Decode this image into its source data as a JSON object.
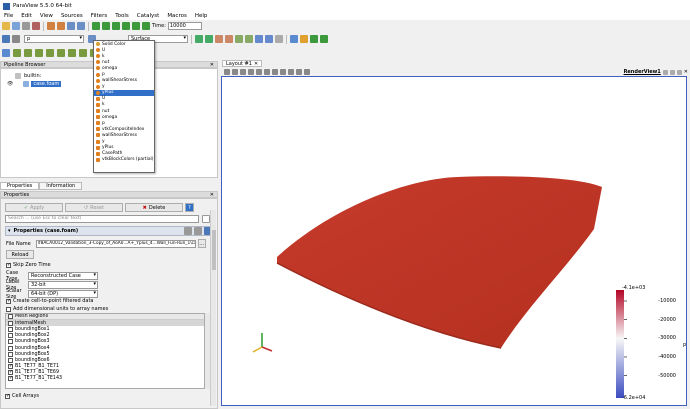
{
  "window": {
    "title": "ParaView 5.5.0 64-bit"
  },
  "menu": [
    "File",
    "Edit",
    "View",
    "Sources",
    "Filters",
    "Tools",
    "Catalyst",
    "Macros",
    "Help"
  ],
  "toolbar": {
    "time_label": "Time:",
    "time_value": "10000",
    "representation": "Surface",
    "coloring_value": "p"
  },
  "dropdown": {
    "items": [
      {
        "label": "Solid Color",
        "kind": "solid"
      },
      {
        "label": "U",
        "kind": "point"
      },
      {
        "label": "k",
        "kind": "point"
      },
      {
        "label": "nut",
        "kind": "point"
      },
      {
        "label": "omega",
        "kind": "point"
      },
      {
        "label": "p",
        "kind": "point"
      },
      {
        "label": "wallShearStress",
        "kind": "point"
      },
      {
        "label": "y",
        "kind": "point"
      },
      {
        "label": "yPlus",
        "kind": "point",
        "selected": true
      },
      {
        "label": "U",
        "kind": "cell"
      },
      {
        "label": "k",
        "kind": "cell"
      },
      {
        "label": "nut",
        "kind": "cell"
      },
      {
        "label": "omega",
        "kind": "cell"
      },
      {
        "label": "p",
        "kind": "cell"
      },
      {
        "label": "vtkCompositeIndex",
        "kind": "cell"
      },
      {
        "label": "wallShearStress",
        "kind": "cell"
      },
      {
        "label": "y",
        "kind": "cell"
      },
      {
        "label": "yPlus",
        "kind": "cell"
      },
      {
        "label": "CasePath",
        "kind": "cell"
      },
      {
        "label": "vtkBlockColors (partial)",
        "kind": "cell"
      }
    ]
  },
  "pipeline": {
    "header": "Pipeline Browser",
    "items": [
      "builtin:",
      "case.foam"
    ]
  },
  "tabs": [
    "Properties",
    "Information"
  ],
  "properties": {
    "header": "Properties",
    "apply": "Apply",
    "reset": "Reset",
    "delete": "Delete",
    "search_placeholder": "Search ... (use Esc to clear text)",
    "section_title": "Properties (case.foam)",
    "file_name_label": "File Name",
    "file_name_value": "\\f8ACA0012_Validation_3-Copy_of_AoA0...A+_Yplus_4...Wall_Fun-Run_1\\case.foam",
    "reload": "Reload",
    "skip_zero_time": "Skip Zero Time",
    "case_type_label": "Case Type",
    "case_type_value": "Reconstructed Case",
    "label_size_label": "Label Size",
    "label_size_value": "32-bit",
    "scalar_size_label": "Scalar Size",
    "scalar_size_value": "64-bit (DP)",
    "cell_to_point": "Create cell-to-point filtered data",
    "dimensional_units": "Add dimensional units to array names",
    "mesh_regions_header": "Mesh Regions",
    "mesh_regions": [
      {
        "label": "internalMesh",
        "checked": false,
        "highlight": true
      },
      {
        "label": "boundingBox1",
        "checked": false
      },
      {
        "label": "boundingBox2",
        "checked": false
      },
      {
        "label": "boundingBox3",
        "checked": false
      },
      {
        "label": "boundingBox4",
        "checked": false
      },
      {
        "label": "boundingBox5",
        "checked": false
      },
      {
        "label": "boundingBox6",
        "checked": false
      },
      {
        "label": "B1_TE77_B1_TE71",
        "checked": true
      },
      {
        "label": "B1_TE77_B1_TE69",
        "checked": true
      },
      {
        "label": "B1_TE77_B1_TE143",
        "checked": true
      }
    ],
    "cell_arrays": "Cell Arrays"
  },
  "view": {
    "layout_tab": "Layout #1",
    "render_label": "RenderView1",
    "colorbar": {
      "max_label": "-4.1e+03",
      "min_label": "-6.2e+04",
      "ticks": [
        "-10000",
        "-20000",
        "-30000",
        "-40000",
        "-50000"
      ],
      "title": "p",
      "colors": [
        "#b40426",
        "#f7f7f7",
        "#3b4cc0"
      ]
    }
  },
  "colors": {
    "surface": "#c0392b",
    "accent": "#3170c8"
  }
}
